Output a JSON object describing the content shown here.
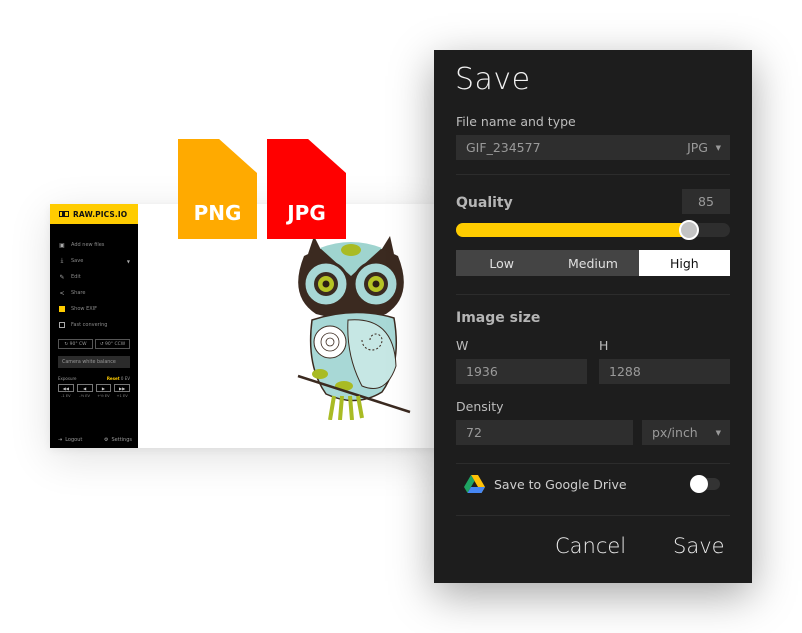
{
  "app": {
    "brand": "RAW.PICS.IO",
    "menu": [
      {
        "label": "Add new files",
        "icon": "add-file-icon"
      },
      {
        "label": "Save",
        "icon": "download-icon",
        "has_submenu": true
      },
      {
        "label": "Edit",
        "icon": "pencil-icon"
      },
      {
        "label": "Share",
        "icon": "share-icon"
      },
      {
        "label": "Show EXIF",
        "icon": "checkbox",
        "checked": true
      },
      {
        "label": "Fast convering",
        "icon": "checkbox",
        "checked": false
      }
    ],
    "rotate_cw": "90° CW",
    "rotate_ccw": "90° CCW",
    "camera_white_balance": "Camera white balance",
    "exposure": {
      "label": "Exposure",
      "reset": "Reset",
      "value": "0 EV",
      "buttons": [
        "◀◀",
        "◀",
        "▶",
        "▶▶"
      ],
      "labels": [
        "-1 EV",
        "-½ EV",
        "+½ EV",
        "+1 EV"
      ]
    },
    "logout": "Logout",
    "settings": "Settings"
  },
  "badges": {
    "png": {
      "label": "PNG",
      "color": "#ffaa00"
    },
    "jpg": {
      "label": "JPG",
      "color": "#ff0000"
    }
  },
  "dialog": {
    "title": "Save",
    "file_label": "File name and type",
    "file_name": "GIF_234577",
    "file_type": "JPG",
    "quality_label": "Quality",
    "quality_value": "85",
    "quality_fraction": 0.85,
    "quality_presets": [
      "Low",
      "Medium",
      "High"
    ],
    "quality_selected": "High",
    "image_size_label": "Image size",
    "width_label": "W",
    "height_label": "H",
    "width_value": "1936",
    "height_value": "1288",
    "density_label": "Density",
    "density_value": "72",
    "density_unit": "px/inch",
    "google_drive_label": "Save to Google Drive",
    "google_drive_enabled": false,
    "cancel": "Cancel",
    "save": "Save"
  },
  "colors": {
    "accent": "#ffcc00",
    "dialog_bg": "#1d1d1d",
    "field_bg": "#2e2e2e"
  }
}
